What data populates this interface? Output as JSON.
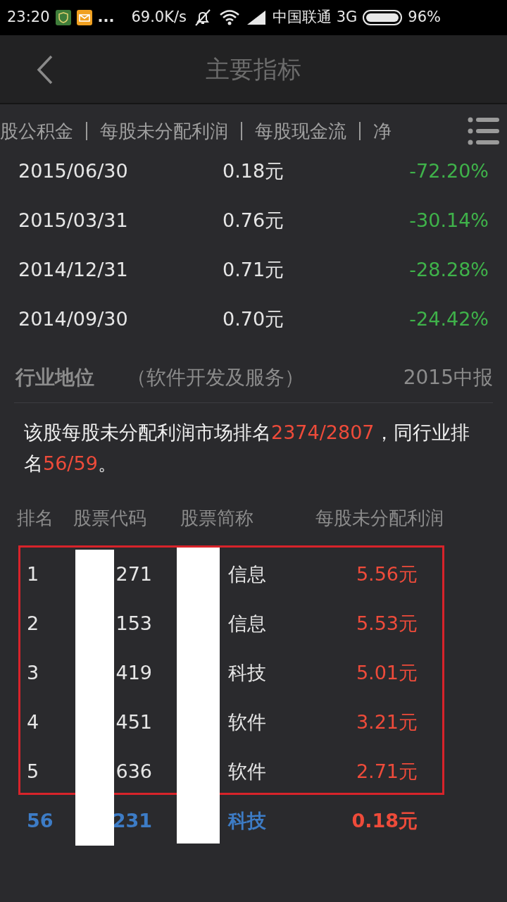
{
  "status_bar": {
    "time": "23:20",
    "more": "...",
    "speed": "69.0K/s",
    "carrier": "中国联通 3G",
    "battery": "96%"
  },
  "header": {
    "title": "主要指标"
  },
  "tabs": [
    "股公积金",
    "每股未分配利润",
    "每股现金流",
    "净"
  ],
  "history": [
    {
      "date": "2015/06/30",
      "value": "0.18元",
      "change": "-72.20%"
    },
    {
      "date": "2015/03/31",
      "value": "0.76元",
      "change": "-30.14%"
    },
    {
      "date": "2014/12/31",
      "value": "0.71元",
      "change": "-28.28%"
    },
    {
      "date": "2014/09/30",
      "value": "0.70元",
      "change": "-24.42%"
    }
  ],
  "industry": {
    "title": "行业地位",
    "sector": "（软件开发及服务）",
    "period": "2015中报",
    "summary": [
      {
        "text": "该股每股未分配利润市场排名",
        "highlight": false
      },
      {
        "text": "2374/2807",
        "highlight": true
      },
      {
        "text": "，同行业排名",
        "highlight": false
      },
      {
        "text": "56/59",
        "highlight": true
      },
      {
        "text": "。",
        "highlight": false
      }
    ]
  },
  "table": {
    "columns": [
      "排名",
      "股票代码",
      "股票简称",
      "每股未分配利润"
    ],
    "rows": [
      {
        "rank": "1",
        "code": "271",
        "name": "信息",
        "value": "5.56元",
        "current": false
      },
      {
        "rank": "2",
        "code": "153",
        "name": "信息",
        "value": "5.53元",
        "current": false
      },
      {
        "rank": "3",
        "code": "419",
        "name": "科技",
        "value": "5.01元",
        "current": false
      },
      {
        "rank": "4",
        "code": "451",
        "name": "软件",
        "value": "3.21元",
        "current": false
      },
      {
        "rank": "5",
        "code": "636",
        "name": "软件",
        "value": "2.71元",
        "current": false
      },
      {
        "rank": "56",
        "code": "231",
        "name": "科技",
        "value": "0.18元",
        "current": true
      }
    ]
  }
}
